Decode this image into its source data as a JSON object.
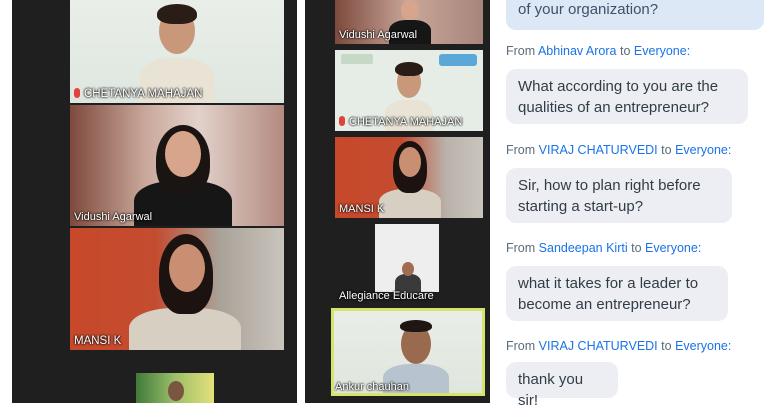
{
  "participants": {
    "chetanya_main": "CHETANYA MAHAJAN",
    "vidushi_main": "Vidushi Agarwal",
    "mansi_main": "MANSI K",
    "vidushi_small": "Vidushi Agarwal",
    "chetanya_small": "CHETANYA MAHAJAN",
    "mansi_small": "MANSI K",
    "allegiance_small": "Allegiance Educare",
    "ankur_small": "Ankur chauhan"
  },
  "chat": {
    "top_fragment": "of your organization?",
    "messages": [
      {
        "from_prefix": "From",
        "sender": "Abhinav Arora",
        "to_prefix": "to",
        "recipient": "Everyone:",
        "lines": [
          "What according to you are the",
          "qualities of an entrepreneur?"
        ]
      },
      {
        "from_prefix": "From",
        "sender": "VIRAJ CHATURVEDI",
        "to_prefix": "to",
        "recipient": "Everyone:",
        "lines": [
          "Sir, how to plan right before",
          "starting a start-up?"
        ]
      },
      {
        "from_prefix": "From",
        "sender": "Sandeepan Kirti",
        "to_prefix": "to",
        "recipient": "Everyone:",
        "lines": [
          "what it takes for a leader to",
          "become an entrepreneur?"
        ]
      },
      {
        "from_prefix": "From",
        "sender": "VIRAJ CHATURVEDI",
        "to_prefix": "to",
        "recipient": "Everyone:",
        "lines": [
          "thank you sir!"
        ]
      }
    ]
  },
  "colors": {
    "chat_sender": "#1a73e8",
    "bubble": "#eceef3",
    "active_speaker_border": "#d7e36a",
    "gallery_bg": "#1f1f1f"
  }
}
